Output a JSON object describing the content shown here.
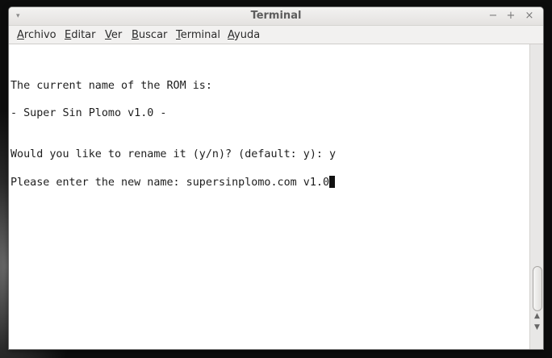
{
  "window": {
    "title": "Terminal",
    "minimize_glyph": "−",
    "maximize_glyph": "+",
    "close_glyph": "×",
    "menu_glyph": "▾"
  },
  "menubar": {
    "items": [
      {
        "label": "Archivo",
        "mnemonic": "A",
        "rest": "rchivo"
      },
      {
        "label": "Editar",
        "mnemonic": "E",
        "rest": "ditar"
      },
      {
        "label": "Ver",
        "mnemonic": "V",
        "rest": "er"
      },
      {
        "label": "Buscar",
        "mnemonic": "B",
        "rest": "uscar"
      },
      {
        "label": "Terminal",
        "mnemonic": "T",
        "rest": "erminal"
      },
      {
        "label": "Ayuda",
        "mnemonic": "A",
        "rest": "yuda"
      }
    ]
  },
  "terminal": {
    "lines": [
      "The current name of the ROM is:",
      "- Super Sin Plomo v1.0 -",
      "Would you like to rename it (y/n)? (default: y): y",
      "Please enter the new name: supersinplomo.com v1.0"
    ]
  },
  "scrollbar": {
    "up_glyph": "▲",
    "down_glyph": "▼"
  }
}
